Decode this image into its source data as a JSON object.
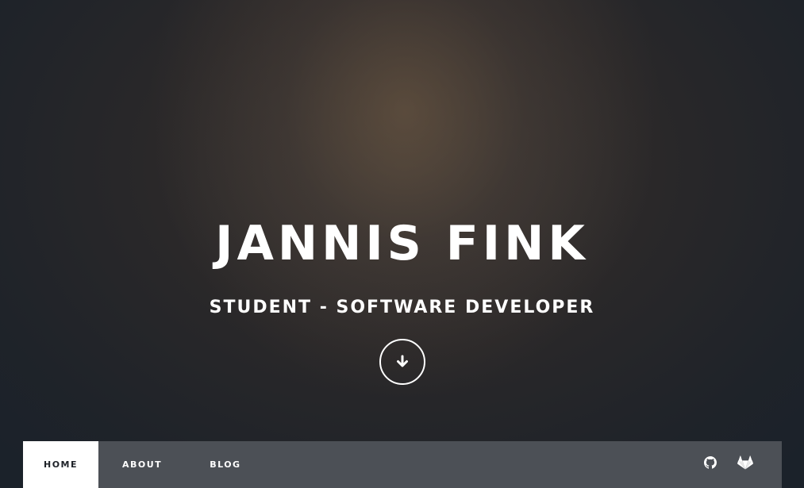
{
  "hero": {
    "title": "JANNIS FINK",
    "subtitle": "STUDENT - SOFTWARE DEVELOPER",
    "scroll_icon": "arrow-down-icon"
  },
  "nav": {
    "items": [
      {
        "label": "HOME",
        "active": true
      },
      {
        "label": "ABOUT",
        "active": false
      },
      {
        "label": "BLOG",
        "active": false
      }
    ],
    "social": [
      {
        "icon": "github-icon"
      },
      {
        "icon": "gitlab-icon"
      }
    ]
  },
  "colors": {
    "navbar_bg": "#4c5056",
    "active_bg": "#ffffff",
    "text": "#ffffff"
  }
}
